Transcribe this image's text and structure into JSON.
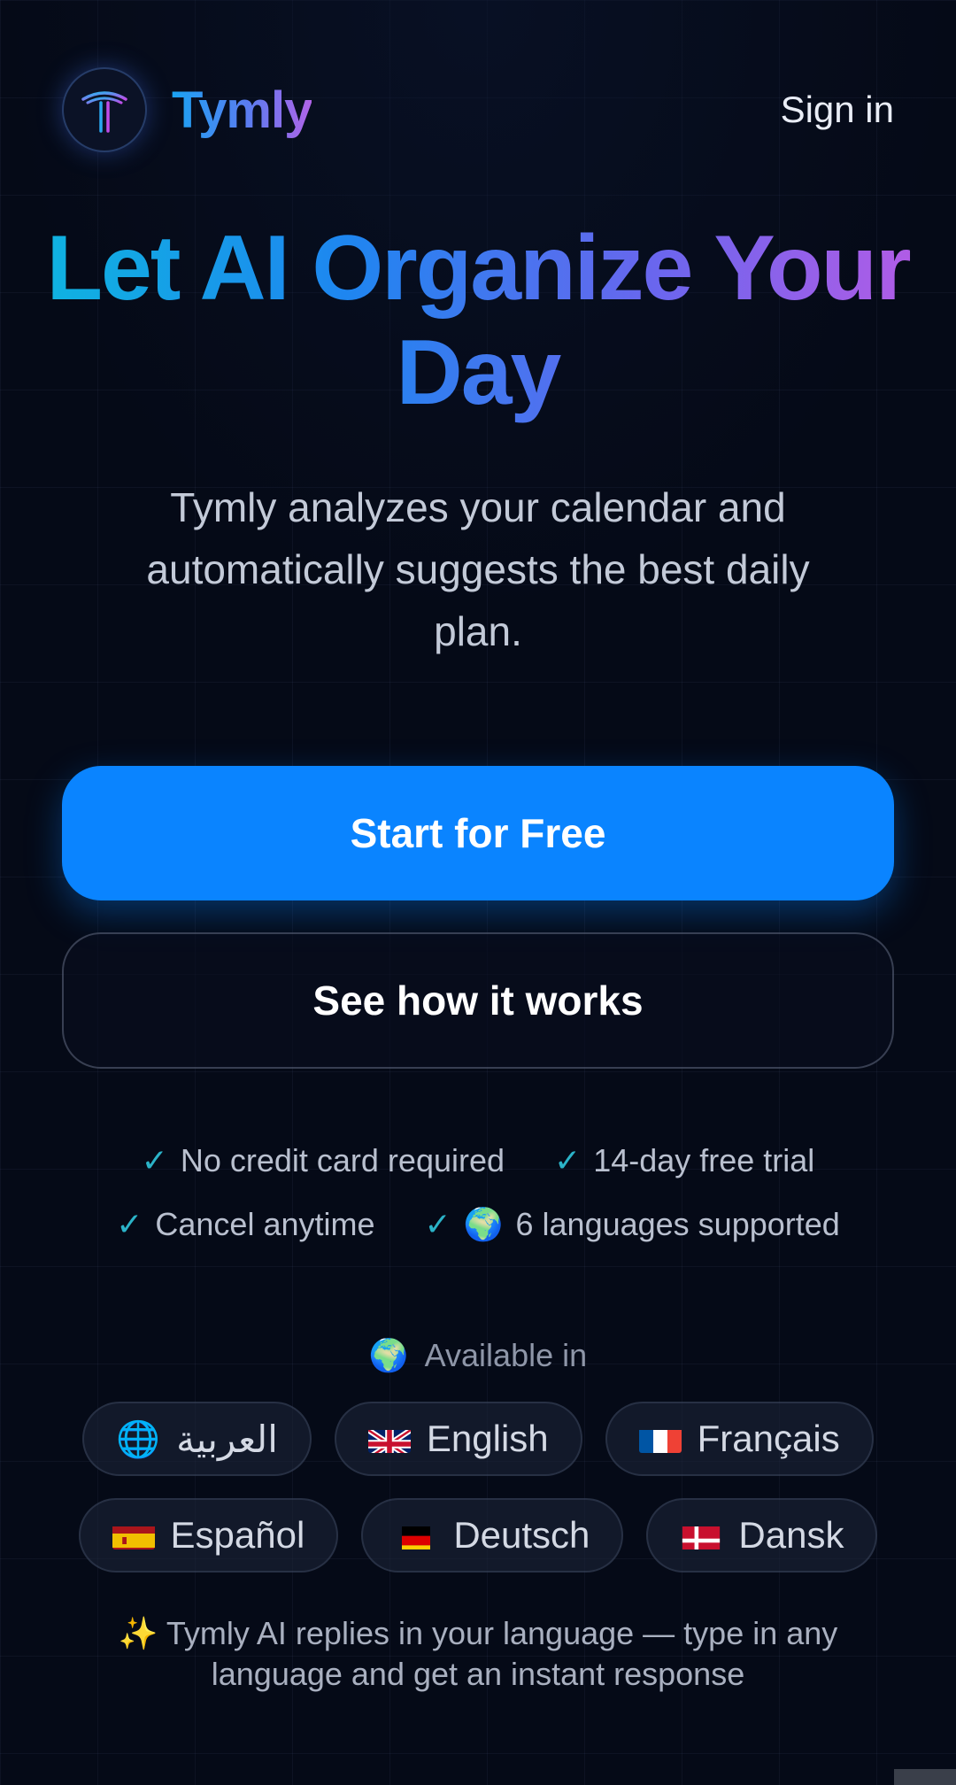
{
  "header": {
    "brand_name": "Tymly",
    "logo_icon": "tymly-t-logo-icon",
    "signin_label": "Sign in"
  },
  "hero": {
    "title": "Let AI Organize Your Day",
    "subtitle": "Tymly analyzes your calendar and automatically suggests the best daily plan."
  },
  "buttons": {
    "primary_label": "Start for Free",
    "secondary_label": "See how it works"
  },
  "features": [
    {
      "label": "No credit card required"
    },
    {
      "label": "14-day free trial"
    },
    {
      "label": "Cancel anytime"
    },
    {
      "label": "6 languages supported",
      "icon": "🌍"
    }
  ],
  "languages": {
    "heading": "Available in",
    "heading_icon": "🌍",
    "items": [
      {
        "label": "العربية",
        "icon": "🌐"
      },
      {
        "label": "English",
        "icon": "uk-flag"
      },
      {
        "label": "Français",
        "icon": "france-flag"
      },
      {
        "label": "Español",
        "icon": "spain-flag"
      },
      {
        "label": "Deutsch",
        "icon": "germany-flag"
      },
      {
        "label": "Dansk",
        "icon": "denmark-flag"
      }
    ]
  },
  "footnote": {
    "icon": "✨",
    "text": "Tymly AI replies in your language — type in any language and get an instant response"
  },
  "colors": {
    "primary": "#0a84ff",
    "check": "#2bb3c8",
    "background": "#050a17"
  }
}
